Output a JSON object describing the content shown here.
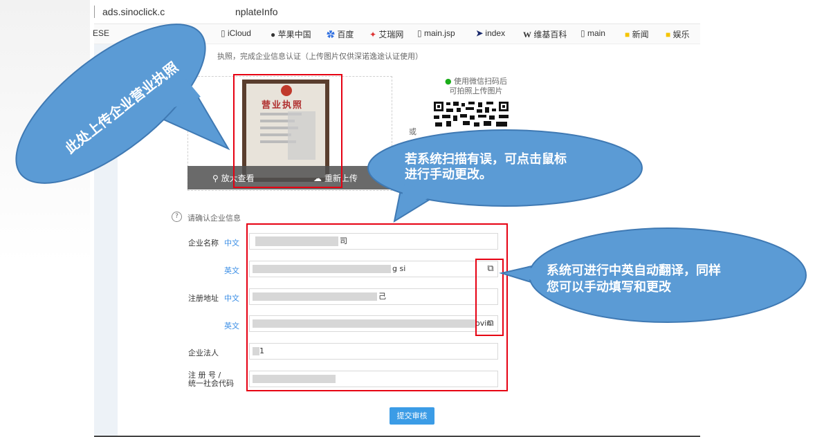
{
  "browser": {
    "url": "ads.sinoclick.com/...templateInfo",
    "url_visible_left": "ads.sinoclick.c",
    "url_visible_right": "nplateInfo",
    "bookmarks": [
      "ESE",
      "iCloud",
      "苹果中国",
      "百度",
      "艾瑞网",
      "main.jsp",
      "index",
      "维基百科",
      "main",
      "新闻",
      "娱乐"
    ]
  },
  "upload": {
    "instruction": "执照，完成企业信息认证（上传图片仅供深诺逸途认证使用）",
    "zoom_label": "放大查看",
    "reupload_label": "重新上传",
    "or_label": "或",
    "license_title": "营业执照",
    "wechat_tip_line1": "使用微信扫码后",
    "wechat_tip_line2": "可拍照上传图片"
  },
  "form": {
    "confirm_label": "请确认企业信息",
    "company_name_label": "企业名称",
    "zh_label": "中文",
    "en_label": "英文",
    "company_name_zh_tail": "司",
    "company_name_en_tail": "g si",
    "address_label": "注册地址",
    "address_zh_tail": "己",
    "address_en_tail": "ovin",
    "legal_person_label": "企业法人",
    "legal_person_tail": "1",
    "reg_no_label_line1": "注 册 号 /",
    "reg_no_label_line2": "统一社会代码",
    "submit_label": "提交审核"
  },
  "annotations": {
    "upload_bubble": "此处上传企业营业执照",
    "edit_bubble_line1": "若系统扫描有误，可点击鼠标",
    "edit_bubble_line2": "进行手动更改。",
    "translate_bubble_line1": "系统可进行中英自动翻译，同样",
    "translate_bubble_line2": "您可以手动填写和更改"
  },
  "colors": {
    "accent": "#3b9ce6",
    "annotation_red": "#e60012",
    "bubble_blue": "#5b9bd5"
  }
}
